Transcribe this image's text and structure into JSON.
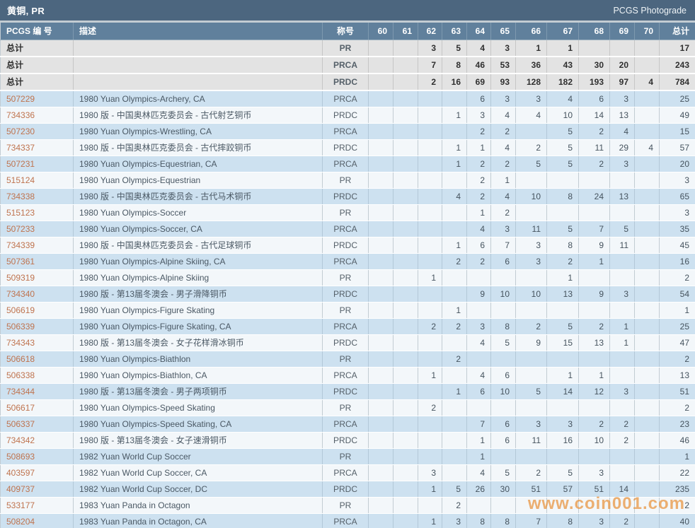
{
  "header": {
    "title": "黄铜, PR",
    "right_label": "PCGS Photograde"
  },
  "watermark": "www.coin001.com",
  "columns": {
    "number": "PCGS 编 号",
    "description": "描述",
    "designation": "称号",
    "grades": [
      "60",
      "61",
      "62",
      "63",
      "64",
      "65",
      "66",
      "67",
      "68",
      "69",
      "70"
    ],
    "total": "总计"
  },
  "totals": [
    {
      "label": "总计",
      "designation": "PR",
      "grades": {
        "62": 3,
        "63": 5,
        "64": 4,
        "65": 3,
        "66": 1,
        "67": 1
      },
      "total": 17
    },
    {
      "label": "总计",
      "designation": "PRCA",
      "grades": {
        "62": 7,
        "63": 8,
        "64": 46,
        "65": 53,
        "66": 36,
        "67": 43,
        "68": 30,
        "69": 20
      },
      "total": 243
    },
    {
      "label": "总计",
      "designation": "PRDC",
      "grades": {
        "62": 2,
        "63": 16,
        "64": 69,
        "65": 93,
        "66": 128,
        "67": 182,
        "68": 193,
        "69": 97,
        "70": 4
      },
      "total": 784
    }
  ],
  "rows": [
    {
      "number": "507229",
      "description": "1980 Yuan Olympics-Archery, CA",
      "designation": "PRCA",
      "grades": {
        "64": 6,
        "65": 3,
        "66": 3,
        "67": 4,
        "68": 6,
        "69": 3
      },
      "total": 25
    },
    {
      "number": "734336",
      "description": "1980 版 - 中国奥林匹克委员会 - 古代射艺铜币",
      "designation": "PRDC",
      "grades": {
        "63": 1,
        "64": 3,
        "65": 4,
        "66": 4,
        "67": 10,
        "68": 14,
        "69": 13
      },
      "total": 49
    },
    {
      "number": "507230",
      "description": "1980 Yuan Olympics-Wrestling, CA",
      "designation": "PRCA",
      "grades": {
        "64": 2,
        "65": 2,
        "67": 5,
        "68": 2,
        "69": 4
      },
      "total": 15
    },
    {
      "number": "734337",
      "description": "1980 版 - 中国奥林匹克委员会 - 古代摔跤铜币",
      "designation": "PRDC",
      "grades": {
        "63": 1,
        "64": 1,
        "65": 4,
        "66": 2,
        "67": 5,
        "68": 11,
        "69": 29,
        "70": 4
      },
      "total": 57
    },
    {
      "number": "507231",
      "description": "1980 Yuan Olympics-Equestrian, CA",
      "designation": "PRCA",
      "grades": {
        "63": 1,
        "64": 2,
        "65": 2,
        "66": 5,
        "67": 5,
        "68": 2,
        "69": 3
      },
      "total": 20
    },
    {
      "number": "515124",
      "description": "1980 Yuan Olympics-Equestrian",
      "designation": "PR",
      "grades": {
        "64": 2,
        "65": 1
      },
      "total": 3
    },
    {
      "number": "734338",
      "description": "1980 版 - 中国奥林匹克委员会 - 古代马术铜币",
      "designation": "PRDC",
      "grades": {
        "63": 4,
        "64": 2,
        "65": 4,
        "66": 10,
        "67": 8,
        "68": 24,
        "69": 13
      },
      "total": 65
    },
    {
      "number": "515123",
      "description": "1980 Yuan Olympics-Soccer",
      "designation": "PR",
      "grades": {
        "64": 1,
        "65": 2
      },
      "total": 3
    },
    {
      "number": "507233",
      "description": "1980 Yuan Olympics-Soccer, CA",
      "designation": "PRCA",
      "grades": {
        "64": 4,
        "65": 3,
        "66": 11,
        "67": 5,
        "68": 7,
        "69": 5
      },
      "total": 35
    },
    {
      "number": "734339",
      "description": "1980 版 - 中国奥林匹克委员会 - 古代足球铜币",
      "designation": "PRDC",
      "grades": {
        "63": 1,
        "64": 6,
        "65": 7,
        "66": 3,
        "67": 8,
        "68": 9,
        "69": 11
      },
      "total": 45
    },
    {
      "number": "507361",
      "description": "1980 Yuan Olympics-Alpine Skiing, CA",
      "designation": "PRCA",
      "grades": {
        "63": 2,
        "64": 2,
        "65": 6,
        "66": 3,
        "67": 2,
        "68": 1
      },
      "total": 16
    },
    {
      "number": "509319",
      "description": "1980 Yuan Olympics-Alpine Skiing",
      "designation": "PR",
      "grades": {
        "62": 1,
        "67": 1
      },
      "total": 2
    },
    {
      "number": "734340",
      "description": "1980 版 - 第13届冬澳会 - 男子滑降铜币",
      "designation": "PRDC",
      "grades": {
        "64": 9,
        "65": 10,
        "66": 10,
        "67": 13,
        "68": 9,
        "69": 3
      },
      "total": 54
    },
    {
      "number": "506619",
      "description": "1980 Yuan Olympics-Figure Skating",
      "designation": "PR",
      "grades": {
        "63": 1
      },
      "total": 1
    },
    {
      "number": "506339",
      "description": "1980 Yuan Olympics-Figure Skating, CA",
      "designation": "PRCA",
      "grades": {
        "62": 2,
        "63": 2,
        "64": 3,
        "65": 8,
        "66": 2,
        "67": 5,
        "68": 2,
        "69": 1
      },
      "total": 25
    },
    {
      "number": "734343",
      "description": "1980 版 - 第13届冬澳会 - 女子花样滑冰铜币",
      "designation": "PRDC",
      "grades": {
        "64": 4,
        "65": 5,
        "66": 9,
        "67": 15,
        "68": 13,
        "69": 1
      },
      "total": 47
    },
    {
      "number": "506618",
      "description": "1980 Yuan Olympics-Biathlon",
      "designation": "PR",
      "grades": {
        "63": 2
      },
      "total": 2
    },
    {
      "number": "506338",
      "description": "1980 Yuan Olympics-Biathlon, CA",
      "designation": "PRCA",
      "grades": {
        "62": 1,
        "64": 4,
        "65": 6,
        "67": 1,
        "68": 1
      },
      "total": 13
    },
    {
      "number": "734344",
      "description": "1980 版 - 第13届冬澳会 - 男子两项铜币",
      "designation": "PRDC",
      "grades": {
        "63": 1,
        "64": 6,
        "65": 10,
        "66": 5,
        "67": 14,
        "68": 12,
        "69": 3
      },
      "total": 51
    },
    {
      "number": "506617",
      "description": "1980 Yuan Olympics-Speed Skating",
      "designation": "PR",
      "grades": {
        "62": 2
      },
      "total": 2
    },
    {
      "number": "506337",
      "description": "1980 Yuan Olympics-Speed Skating, CA",
      "designation": "PRCA",
      "grades": {
        "64": 7,
        "65": 6,
        "66": 3,
        "67": 3,
        "68": 2,
        "69": 2
      },
      "total": 23
    },
    {
      "number": "734342",
      "description": "1980 版 - 第13届冬澳会 - 女子速滑铜币",
      "designation": "PRDC",
      "grades": {
        "64": 1,
        "65": 6,
        "66": 11,
        "67": 16,
        "68": 10,
        "69": 2
      },
      "total": 46
    },
    {
      "number": "508693",
      "description": "1982 Yuan World Cup Soccer",
      "designation": "PR",
      "grades": {
        "64": 1
      },
      "total": 1
    },
    {
      "number": "403597",
      "description": "1982 Yuan World Cup Soccer, CA",
      "designation": "PRCA",
      "grades": {
        "62": 3,
        "64": 4,
        "65": 5,
        "66": 2,
        "67": 5,
        "68": 3
      },
      "total": 22
    },
    {
      "number": "409737",
      "description": "1982 Yuan World Cup Soccer, DC",
      "designation": "PRDC",
      "grades": {
        "62": 1,
        "63": 5,
        "64": 26,
        "65": 30,
        "66": 51,
        "67": 57,
        "68": 51,
        "69": 14
      },
      "total": 235
    },
    {
      "number": "533177",
      "description": "1983 Yuan Panda in Octagon",
      "designation": "PR",
      "grades": {
        "63": 2
      },
      "total": 2
    },
    {
      "number": "508204",
      "description": "1983 Yuan Panda in Octagon, CA",
      "designation": "PRCA",
      "grades": {
        "62": 1,
        "63": 3,
        "64": 8,
        "65": 8,
        "66": 7,
        "67": 8,
        "68": 3,
        "69": 2
      },
      "total": 40
    }
  ]
}
